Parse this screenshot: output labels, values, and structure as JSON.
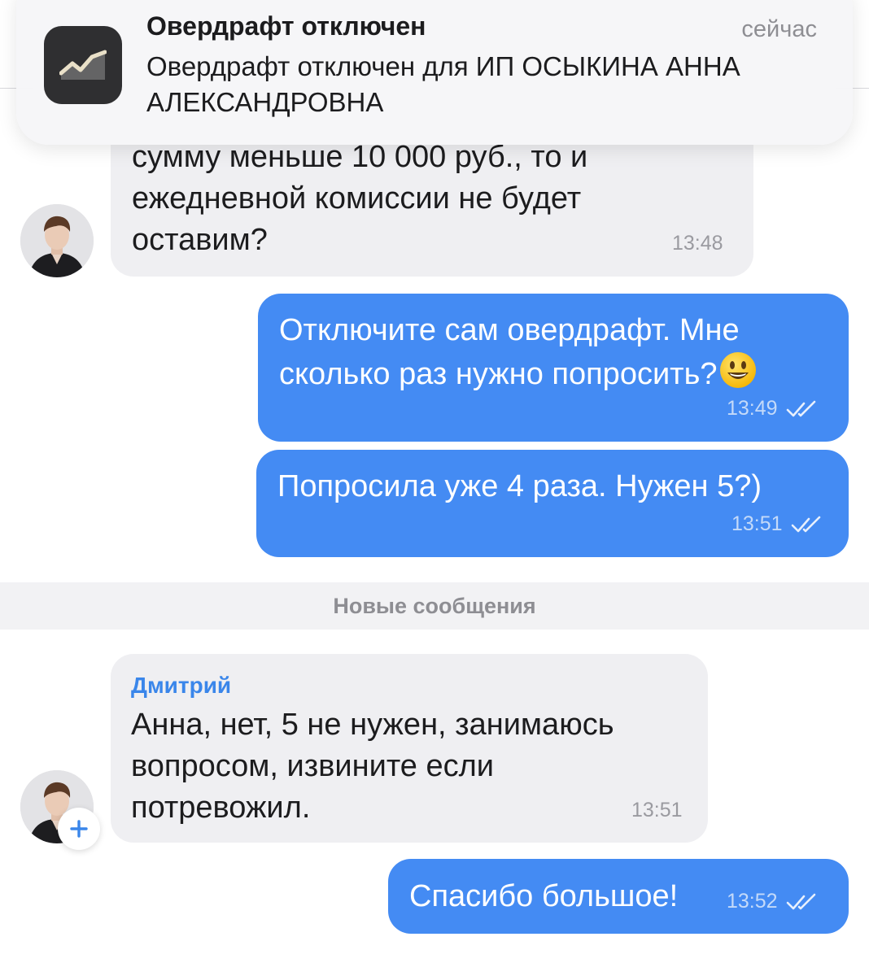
{
  "notification": {
    "title": "Овердрафт отключен",
    "time": "сейчас",
    "body": "Овердрафт отключен для ИП ОСЫКИНА АННА АЛЕКСАНДРОВНА",
    "app_icon": "chart-trend-icon"
  },
  "messages": {
    "m1": {
      "text_line1": "сумму меньше 10 000 руб., то и",
      "text_line2": "ежедневной комиссии не будет",
      "text_line3": "оставим?",
      "time": "13:48"
    },
    "m2": {
      "text_line1": "Отключите сам овердрафт. Мне",
      "text_line2": "сколько раз нужно попросить?",
      "emoji": "smiley-emoji",
      "time": "13:49"
    },
    "m3": {
      "text": "Попросила уже 4 раза. Нужен 5?)",
      "time": "13:51"
    },
    "separator": "Новые сообщения",
    "m4": {
      "sender": "Дмитрий",
      "text_line1": "Анна, нет, 5 не нужен, занимаюсь",
      "text_line2": "вопросом, извините если",
      "text_line3": "потревожил.",
      "time": "13:51"
    },
    "m5": {
      "text": "Спасибо большое!",
      "time": "13:52"
    }
  },
  "colors": {
    "outgoing_bubble": "#448bf3",
    "incoming_bubble": "#efeff2",
    "accent": "#3a86ea"
  }
}
